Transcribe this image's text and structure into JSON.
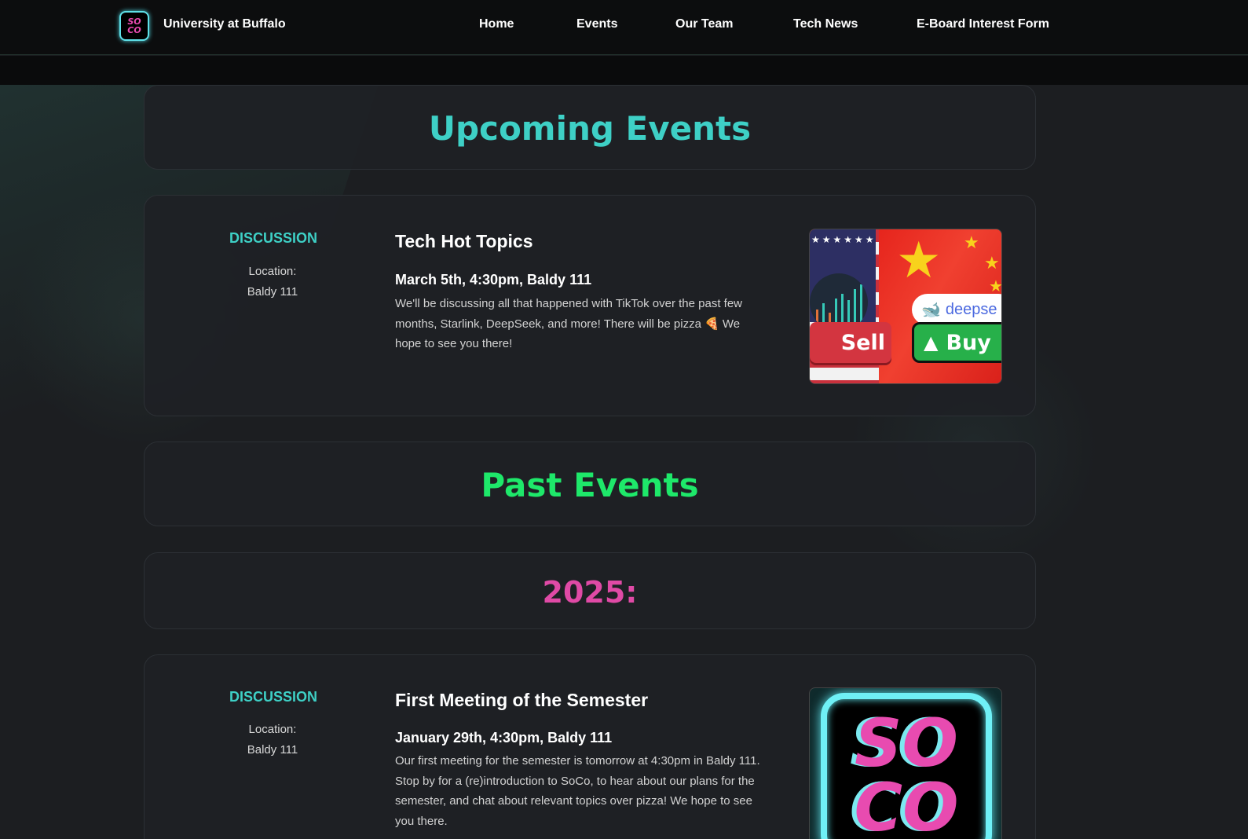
{
  "navbar": {
    "logo_text": "SO CO",
    "brand": "University at Buffalo",
    "links": [
      {
        "label": "Home"
      },
      {
        "label": "Events"
      },
      {
        "label": "Our Team"
      },
      {
        "label": "Tech News"
      },
      {
        "label": "E-Board Interest Form"
      }
    ]
  },
  "sections": {
    "upcoming_title": "Upcoming Events",
    "past_title": "Past Events",
    "year_title": "2025:"
  },
  "events": [
    {
      "type": "DISCUSSION",
      "location_label": "Location:",
      "location": "Baldy 111",
      "title": "Tech Hot Topics",
      "datetime": "March 5th, 4:30pm, Baldy 111",
      "description": "We'll be discussing all that happened with TikTok over the past few months, Starlink, DeepSeek, and more! There will be pizza 🍕 We hope to see you there!",
      "image": {
        "sell_label": "Sell",
        "buy_label": "Buy",
        "deepseek_label": "deepse"
      }
    },
    {
      "type": "DISCUSSION",
      "location_label": "Location:",
      "location": "Baldy 111",
      "title": "First Meeting of the Semester",
      "datetime": "January 29th, 4:30pm, Baldy 111",
      "description": "Our first meeting for the semester is tomorrow at 4:30pm in Baldy 111. Stop by for a (re)introduction to SoCo, to hear about our plans for the semester, and chat about relevant topics over pizza! We hope to see you there.",
      "image": {
        "logo_line1": "SO",
        "logo_line2": "CO"
      }
    }
  ],
  "colors": {
    "accent_teal": "#3ed0c6",
    "accent_green": "#1ee86a",
    "accent_pink": "#e04aa6",
    "background": "#1c1e21"
  }
}
